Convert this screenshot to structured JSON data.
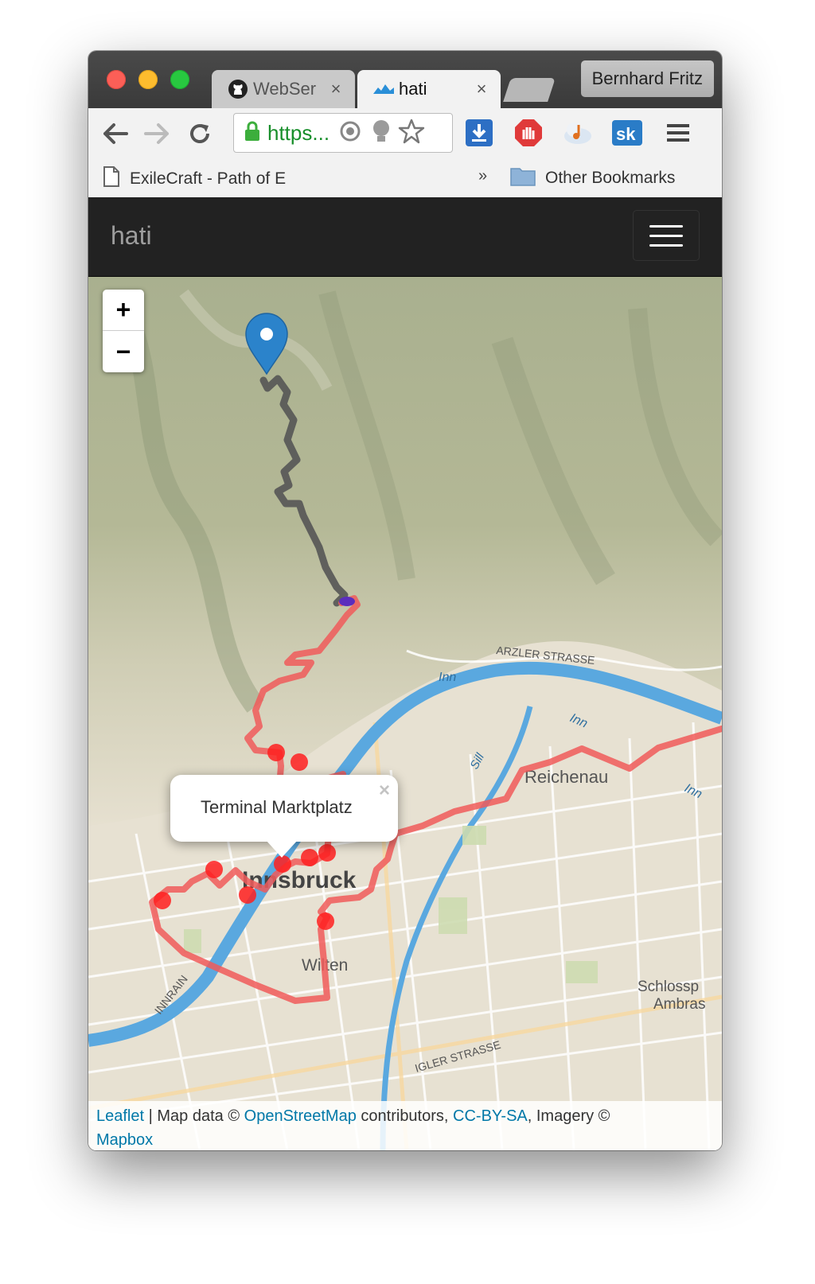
{
  "browser": {
    "tabs": [
      {
        "label": "WebSer",
        "icon": "github-icon",
        "active": false
      },
      {
        "label": "hati",
        "icon": "hati-icon",
        "active": true
      }
    ],
    "tab_close": "×",
    "profile_name": "Bernhard Fritz",
    "omnibox": {
      "url": "https..."
    },
    "bookmarks": {
      "item": "ExileCraft - Path of E",
      "overflow": "»",
      "other": "Other Bookmarks"
    }
  },
  "page": {
    "brand": "hati",
    "nav_toggle": "toggle navigation"
  },
  "map": {
    "zoom_in": "+",
    "zoom_out": "−",
    "popup": {
      "text": "Terminal Marktplatz",
      "close": "×"
    },
    "labels": {
      "city": "Innsbruck",
      "district_reichenau": "Reichenau",
      "district_wilten": "Wilten",
      "street_arzler": "ARZLER STRASSE",
      "river_inn": "Inn",
      "river_inn_2": "Inn",
      "river_inn_3": "Inn",
      "river_sill": "Sill",
      "street_innrain": "INNRAIN",
      "street_igler": "IGLER STRASSE",
      "place_schloss": "Schlossp",
      "place_ambras": "Ambras"
    },
    "colors": {
      "track_done": "#555555",
      "track_route": "#f05a5a",
      "stop": "#ff2020",
      "river": "#5aa8df",
      "marker": "#2b83cb",
      "vehicle": "#5b2dbd"
    },
    "attribution": {
      "leaflet": "Leaflet",
      "sep": "|",
      "map_data": "Map data ©",
      "osm": "OpenStreetMap",
      "contributors": "contributors,",
      "license": "CC-BY-SA",
      "imagery": ", Imagery ©",
      "mapbox": "Mapbox"
    }
  }
}
